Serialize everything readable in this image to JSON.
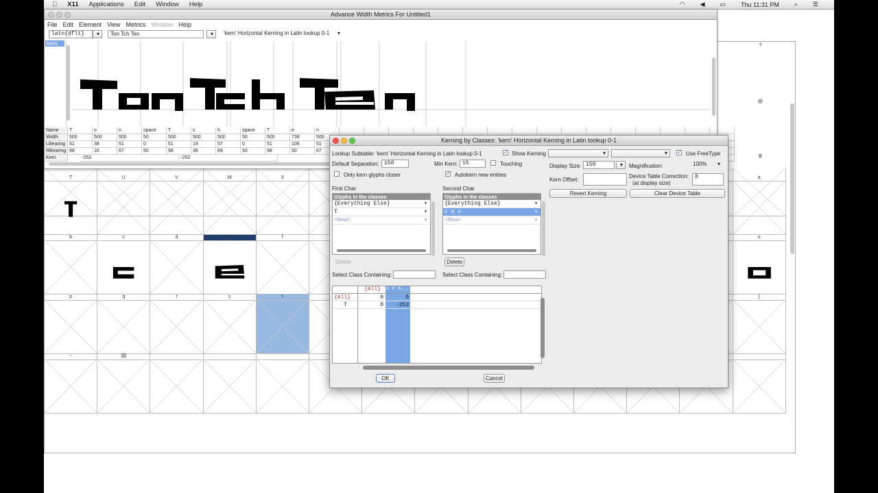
{
  "menubar": {
    "app": "X11",
    "items": [
      "Applications",
      "Edit",
      "Window",
      "Help"
    ],
    "clock": "Thu 11:31 PM"
  },
  "metrics_window": {
    "title": "Advance Width Metrics For Untitled1",
    "menu": [
      "File",
      "Edit",
      "Element",
      "View",
      "Metrics",
      "Window",
      "Help"
    ],
    "script_value": "latn{dflt}",
    "text_value": "Ton Tch Ten",
    "lookup_value": "'kern' Horizontal Kerning in Latin lookup 0-1",
    "feature_list_item": "kern",
    "sample_text": "TonTchTen",
    "rows": {
      "name": {
        "label": "Name",
        "values": [
          "T",
          "o",
          "n",
          "space",
          "T",
          "c",
          "h",
          "space",
          "T",
          "e",
          "n"
        ]
      },
      "width": {
        "label": "Width",
        "values": [
          "500",
          "500",
          "500",
          "50",
          "500",
          "500",
          "500",
          "50",
          "500",
          "738",
          "500"
        ]
      },
      "lbearing": {
        "label": "LBearing",
        "values": [
          "51",
          "38",
          "51",
          "0",
          "51",
          "19",
          "57",
          "0",
          "51",
          "106",
          "51"
        ]
      },
      "rbearing": {
        "label": "RBearing",
        "values": [
          "98",
          "16",
          "67",
          "50",
          "98",
          "36",
          "69",
          "50",
          "98",
          "50",
          "67"
        ]
      },
      "kern": {
        "label": "Kern",
        "values": [
          "-253",
          "",
          "",
          "",
          "-253",
          "",
          "",
          "",
          "",
          "",
          ""
        ]
      }
    }
  },
  "grid": {
    "row1_labels": [
      "T",
      "U",
      "V",
      "W",
      "X"
    ],
    "row2_labels": [
      "b",
      "c",
      "d",
      "e",
      "f"
    ],
    "row3_labels": [
      "p",
      "q",
      "r",
      "s",
      "t"
    ],
    "row4_labels": [
      "~",
      "⌧"
    ],
    "right_labels": [
      "?",
      "@",
      "B",
      "a",
      "o",
      "}"
    ]
  },
  "dialog": {
    "title": "Kerning by Classes: 'kern' Horizontal Kerning in Latin lookup 0-1",
    "lookup_subtable": "Lookup Subtable: 'kern' Horizontal Kerning in Latin lookup 0-1",
    "show_kerning": "Show Kerning",
    "use_freetype": "Use FreeType",
    "default_separation_label": "Default Separation:",
    "default_separation": "150",
    "min_kern_label": "Min Kern:",
    "min_kern": "15",
    "touching": "Touching",
    "only_closer": "Only kern glyphs closer",
    "autokern": "Autokern new entries",
    "display_size_label": "Display Size:",
    "display_size": "150",
    "magnification_label": "Magnification:",
    "magnification": "100%",
    "kern_offset_label": "Kern Offset:",
    "device_table_label": "Device Table Correction:",
    "device_table_sub": "(at display size)",
    "device_table_value": "0",
    "revert_kerning": "Revert Kerning",
    "clear_device_table": "Clear Device Table",
    "first_char": "First Char",
    "second_char": "Second Char",
    "glyphs_in_classes": "Glyphs in the classes",
    "everything_else": "{Everything Else}",
    "first_class": "T",
    "second_class": "c e o",
    "new_entry": "<New>",
    "delete": "Delete",
    "select_class": "Select Class Containing:",
    "table": {
      "col_all": "{All}",
      "col_ceo": "c e o...",
      "rows": [
        {
          "name": "{All}",
          "all": "0",
          "ceo": "0"
        },
        {
          "name": "T",
          "all": "0",
          "ceo": "-253"
        }
      ]
    },
    "ok": "OK",
    "cancel": "Cancel"
  },
  "colors": {
    "selection": "#7aa6e6",
    "highlight_cell": "#97b8e0",
    "glyph": "#000000"
  }
}
